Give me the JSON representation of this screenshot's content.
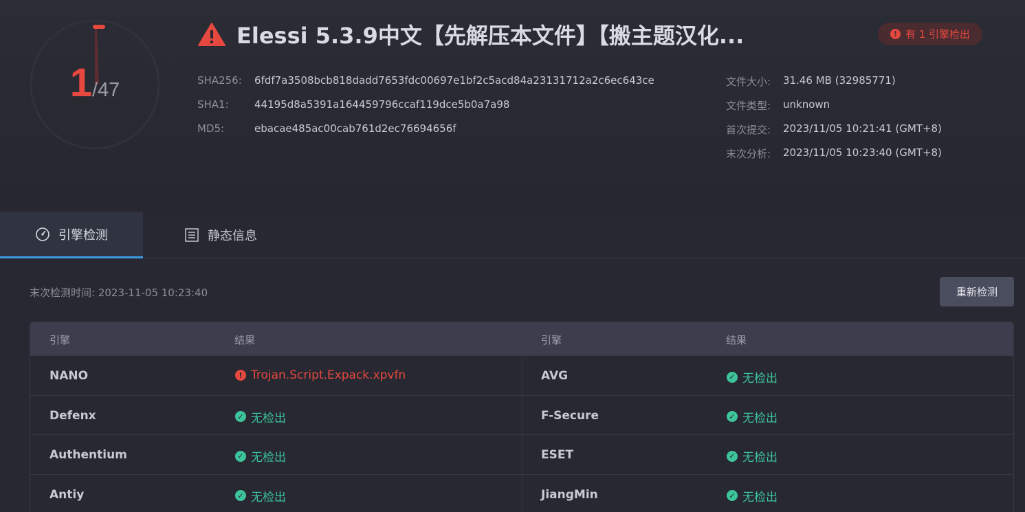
{
  "gauge": {
    "detected": "1",
    "total": "/47"
  },
  "file": {
    "title": "Elessi 5.3.9中文【先解压本文件】【搬主题汉化...",
    "alert_badge": "有 1 引擎检出",
    "alert_badge_icon": "exclamation-icon"
  },
  "hashes": [
    {
      "label": "SHA256:",
      "value": "6fdf7a3508bcb818dadd7653fdc00697e1bf2c5acd84a23131712a2c6ec643ce"
    },
    {
      "label": "SHA1:",
      "value": "44195d8a5391a164459796ccaf119dce5b0a7a98"
    },
    {
      "label": "MD5:",
      "value": "ebacae485ac00cab761d2ec76694656f"
    }
  ],
  "meta": [
    {
      "label": "文件大小:",
      "value": "31.46 MB (32985771)"
    },
    {
      "label": "文件类型:",
      "value": "unknown"
    },
    {
      "label": "首次提交:",
      "value": "2023/11/05 10:21:41 (GMT+8)"
    },
    {
      "label": "末次分析:",
      "value": "2023/11/05 10:23:40 (GMT+8)"
    }
  ],
  "tabs": [
    {
      "label": "引擎检测",
      "icon": "gauge-icon",
      "active": true
    },
    {
      "label": "静态信息",
      "icon": "list-icon",
      "active": false
    }
  ],
  "scan": {
    "last_scan": "末次检测时间: 2023-11-05 10:23:40",
    "rescan_label": "重新检测"
  },
  "table": {
    "headers": [
      "引擎",
      "结果",
      "引擎",
      "结果"
    ],
    "rows": [
      {
        "left": {
          "engine": "NANO",
          "result": "Trojan.Script.Expack.xpvfn",
          "status": "malicious"
        },
        "right": {
          "engine": "AVG",
          "result": "无检出",
          "status": "clean"
        }
      },
      {
        "left": {
          "engine": "Defenx",
          "result": "无检出",
          "status": "clean"
        },
        "right": {
          "engine": "F-Secure",
          "result": "无检出",
          "status": "clean"
        }
      },
      {
        "left": {
          "engine": "Authentium",
          "result": "无检出",
          "status": "clean"
        },
        "right": {
          "engine": "ESET",
          "result": "无检出",
          "status": "clean"
        }
      },
      {
        "left": {
          "engine": "Antiy",
          "result": "无检出",
          "status": "clean"
        },
        "right": {
          "engine": "JiangMin",
          "result": "无检出",
          "status": "clean"
        }
      }
    ]
  },
  "colors": {
    "malicious": "#e5483f",
    "clean": "#3dc49a",
    "accent": "#3d9be6",
    "background": "#272831"
  }
}
